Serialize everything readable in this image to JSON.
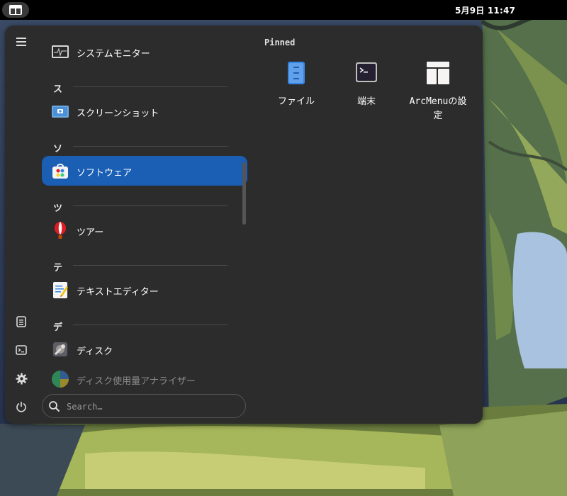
{
  "topbar": {
    "clock": "5月9日  11:47"
  },
  "menu": {
    "apps": [
      {
        "label": "システムモニター",
        "icon": "system-monitor-icon"
      },
      {
        "label": "スクリーンショット",
        "icon": "screenshot-icon"
      },
      {
        "label": "ソフトウェア",
        "icon": "software-icon",
        "selected": true
      },
      {
        "label": "ツアー",
        "icon": "tour-balloon-icon"
      },
      {
        "label": "テキストエディター",
        "icon": "text-editor-icon"
      },
      {
        "label": "ディスク",
        "icon": "disks-icon"
      },
      {
        "label": "ディスク使用量アナライザー",
        "icon": "disk-usage-analyzer-icon"
      }
    ],
    "sections": [
      "ス",
      "ソ",
      "ツ",
      "テ",
      "デ"
    ],
    "search": {
      "placeholder": "Search…"
    },
    "pinned": {
      "title": "Pinned",
      "items": [
        {
          "label": "ファイル",
          "icon": "files-icon"
        },
        {
          "label": "端末",
          "icon": "terminal-icon"
        },
        {
          "label": "ArcMenuの設定",
          "icon": "arcmenu-settings-icon"
        }
      ]
    },
    "side_icons": [
      "hamburger-icon",
      "documents-icon",
      "terminal-icon",
      "settings-gear-icon",
      "power-icon"
    ]
  },
  "colors": {
    "accent": "#1a5fb4",
    "panel": "#2c2c2c",
    "topbar": "#000000"
  }
}
